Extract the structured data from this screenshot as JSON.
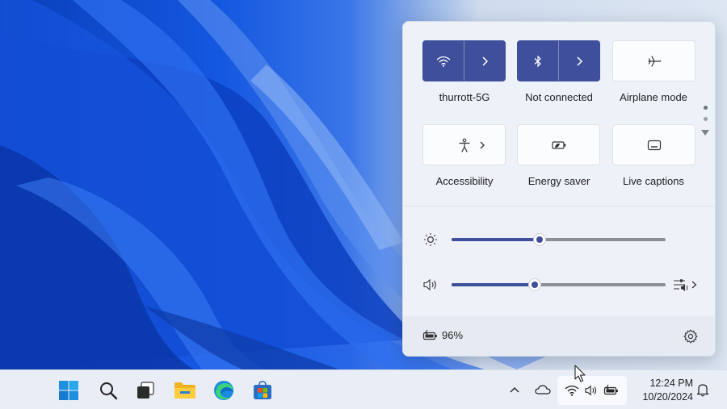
{
  "quick_settings": {
    "tiles": [
      {
        "label": "thurrott-5G",
        "icon": "wifi-icon",
        "state": "on"
      },
      {
        "label": "Not connected",
        "icon": "bluetooth-icon",
        "state": "on"
      },
      {
        "label": "Airplane mode",
        "icon": "airplane-icon",
        "state": "off"
      },
      {
        "label": "Accessibility",
        "icon": "accessibility-icon",
        "state": "off"
      },
      {
        "label": "Energy saver",
        "icon": "energy-saver-icon",
        "state": "off"
      },
      {
        "label": "Live captions",
        "icon": "captions-icon",
        "state": "off"
      }
    ],
    "pager": {
      "pages": 2,
      "current": 1
    },
    "brightness": {
      "icon": "brightness-icon",
      "level": 0.41
    },
    "volume": {
      "icon": "speaker-icon",
      "level": 0.39
    },
    "battery": {
      "icon": "battery-charging-icon",
      "text": "96%"
    },
    "settings_icon": "gear-icon"
  },
  "taskbar": {
    "apps": [
      "windows-start-icon",
      "search-icon",
      "task-view-icon",
      "file-explorer-icon",
      "edge-icon",
      "store-icon"
    ],
    "tray": {
      "icons": [
        "chevron-up-icon",
        "onedrive-cloud-icon",
        "wifi-icon",
        "speaker-icon",
        "battery-icon",
        "bell-icon"
      ]
    },
    "clock": {
      "time": "12:24 PM",
      "date": "10/20/2024"
    }
  },
  "colors": {
    "accent": "#3f4f9c",
    "flyout_bg": "#edf1f8",
    "taskbar_bg": "#e9eef6",
    "wallpaper_blue": "#1457e0"
  }
}
